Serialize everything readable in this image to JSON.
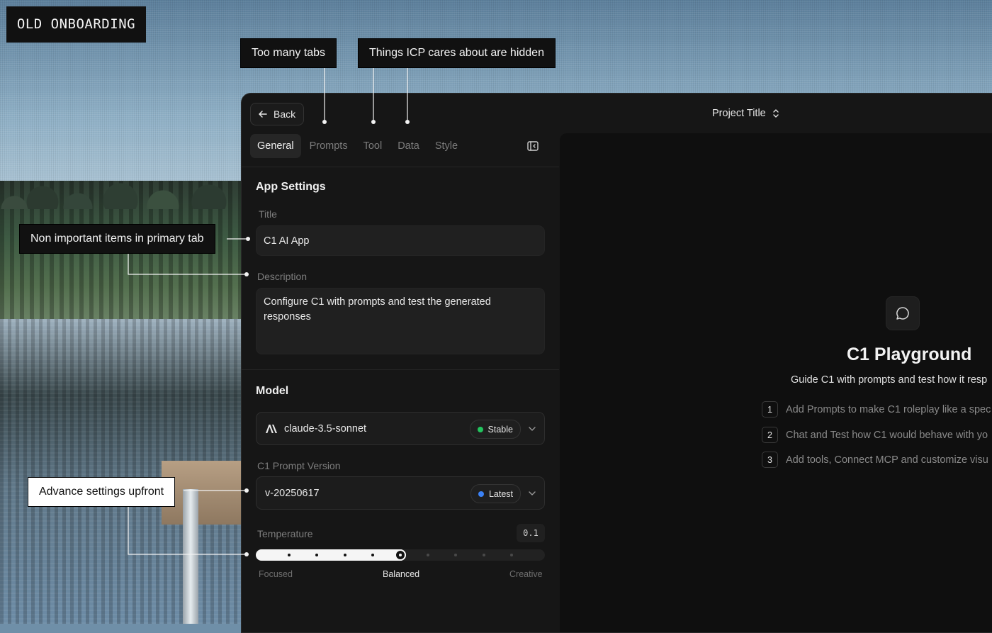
{
  "tag": "OLD ONBOARDING",
  "annotations": {
    "tabs_note": "Too many tabs",
    "hidden_note": "Things ICP cares about are hidden",
    "primary_tab_note": "Non important items in primary tab",
    "advanced_note": "Advance settings upfront"
  },
  "app": {
    "back_label": "Back",
    "project_title": "Project Title",
    "tabs": [
      "General",
      "Prompts",
      "Tool",
      "Data",
      "Style"
    ],
    "active_tab": "General",
    "app_settings": {
      "heading": "App Settings",
      "title_label": "Title",
      "title_value": "C1 AI App",
      "description_label": "Description",
      "description_value": "Configure C1 with prompts and test the generated responses"
    },
    "model": {
      "heading": "Model",
      "model_name": "claude-3.5-sonnet",
      "model_badge": "Stable",
      "prompt_version_label": "C1 Prompt Version",
      "prompt_version": "v-20250617",
      "prompt_badge": "Latest"
    },
    "temperature": {
      "label": "Temperature",
      "value": "0.1",
      "level": 0.5,
      "steps": 10,
      "labels": [
        "Focused",
        "Balanced",
        "Creative"
      ]
    },
    "playground": {
      "title": "C1 Playground",
      "subtitle": "Guide C1 with prompts and test how it resp",
      "steps": [
        {
          "num": "1",
          "text": "Add Prompts to make C1 roleplay like a spec"
        },
        {
          "num": "2",
          "text": "Chat and Test how C1 would behave with yo"
        },
        {
          "num": "3",
          "text": "Add tools, Connect MCP and customize visu"
        }
      ]
    }
  },
  "colors": {
    "stable": "#22c55e",
    "latest": "#3b82f6",
    "panel": "#161616",
    "playground": "#0f0f0f"
  },
  "icons": {
    "back": "arrow-left-icon",
    "project_switch": "chevron-up-down-icon",
    "collapse": "sidebar-collapse-icon",
    "model_logo": "anthropic-logo-icon",
    "dropdown": "chevron-down-icon",
    "chat": "chat-bubble-icon"
  }
}
